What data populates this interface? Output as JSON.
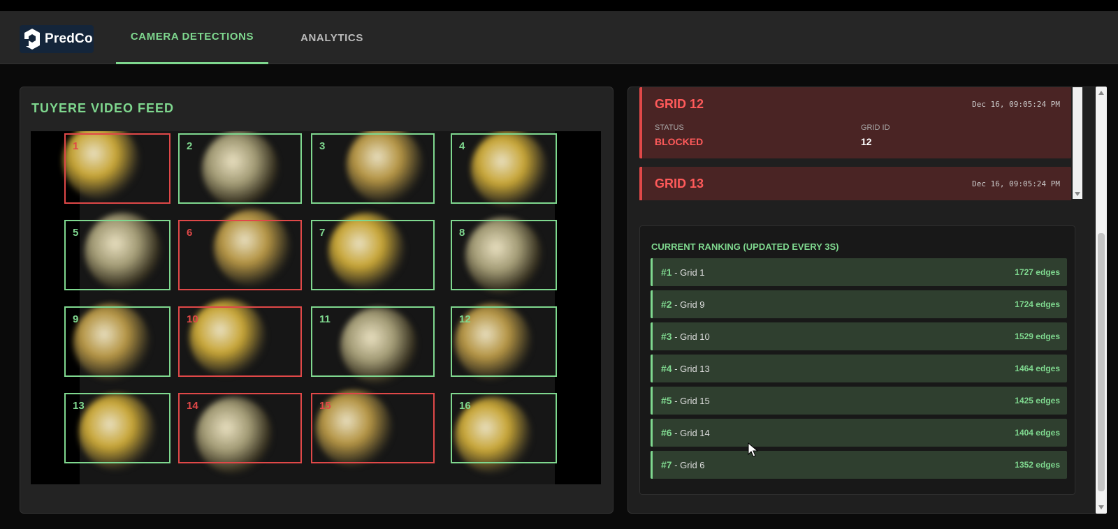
{
  "brand": {
    "name": "PredCo"
  },
  "nav": {
    "tabs": [
      {
        "label": "CAMERA DETECTIONS",
        "active": true
      },
      {
        "label": "ANALYTICS",
        "active": false
      }
    ]
  },
  "feed": {
    "title": "TUYERE VIDEO FEED",
    "grids": [
      {
        "num": "1",
        "status": "blocked"
      },
      {
        "num": "2",
        "status": "ok"
      },
      {
        "num": "3",
        "status": "ok"
      },
      {
        "num": "4",
        "status": "ok"
      },
      {
        "num": "5",
        "status": "ok"
      },
      {
        "num": "6",
        "status": "blocked"
      },
      {
        "num": "7",
        "status": "ok"
      },
      {
        "num": "8",
        "status": "ok"
      },
      {
        "num": "9",
        "status": "ok"
      },
      {
        "num": "10",
        "status": "blocked"
      },
      {
        "num": "11",
        "status": "ok"
      },
      {
        "num": "12",
        "status": "ok"
      },
      {
        "num": "13",
        "status": "ok"
      },
      {
        "num": "14",
        "status": "blocked"
      },
      {
        "num": "15",
        "status": "blocked"
      },
      {
        "num": "16",
        "status": "ok"
      }
    ]
  },
  "alerts": [
    {
      "title": "GRID 12",
      "time": "Dec 16, 09:05:24 PM",
      "status_label": "STATUS",
      "status_value": "BLOCKED",
      "id_label": "GRID ID",
      "id_value": "12"
    },
    {
      "title": "GRID 13",
      "time": "Dec 16, 09:05:24 PM"
    }
  ],
  "ranking": {
    "title": "CURRENT RANKING (UPDATED EVERY 3S)",
    "rows": [
      {
        "rank": "#1",
        "grid": " - Grid 1",
        "edges": "1727 edges"
      },
      {
        "rank": "#2",
        "grid": " - Grid 9",
        "edges": "1724 edges"
      },
      {
        "rank": "#3",
        "grid": " - Grid 10",
        "edges": "1529 edges"
      },
      {
        "rank": "#4",
        "grid": " - Grid 13",
        "edges": "1464 edges"
      },
      {
        "rank": "#5",
        "grid": " - Grid 15",
        "edges": "1425 edges"
      },
      {
        "rank": "#6",
        "grid": " - Grid 14",
        "edges": "1404 edges"
      },
      {
        "rank": "#7",
        "grid": " - Grid 6",
        "edges": "1352 edges"
      }
    ]
  },
  "colors": {
    "accent_green": "#7fd88f",
    "alert_red": "#e04848",
    "alert_bg": "#4a2424",
    "row_bg": "#2f3f2f"
  }
}
